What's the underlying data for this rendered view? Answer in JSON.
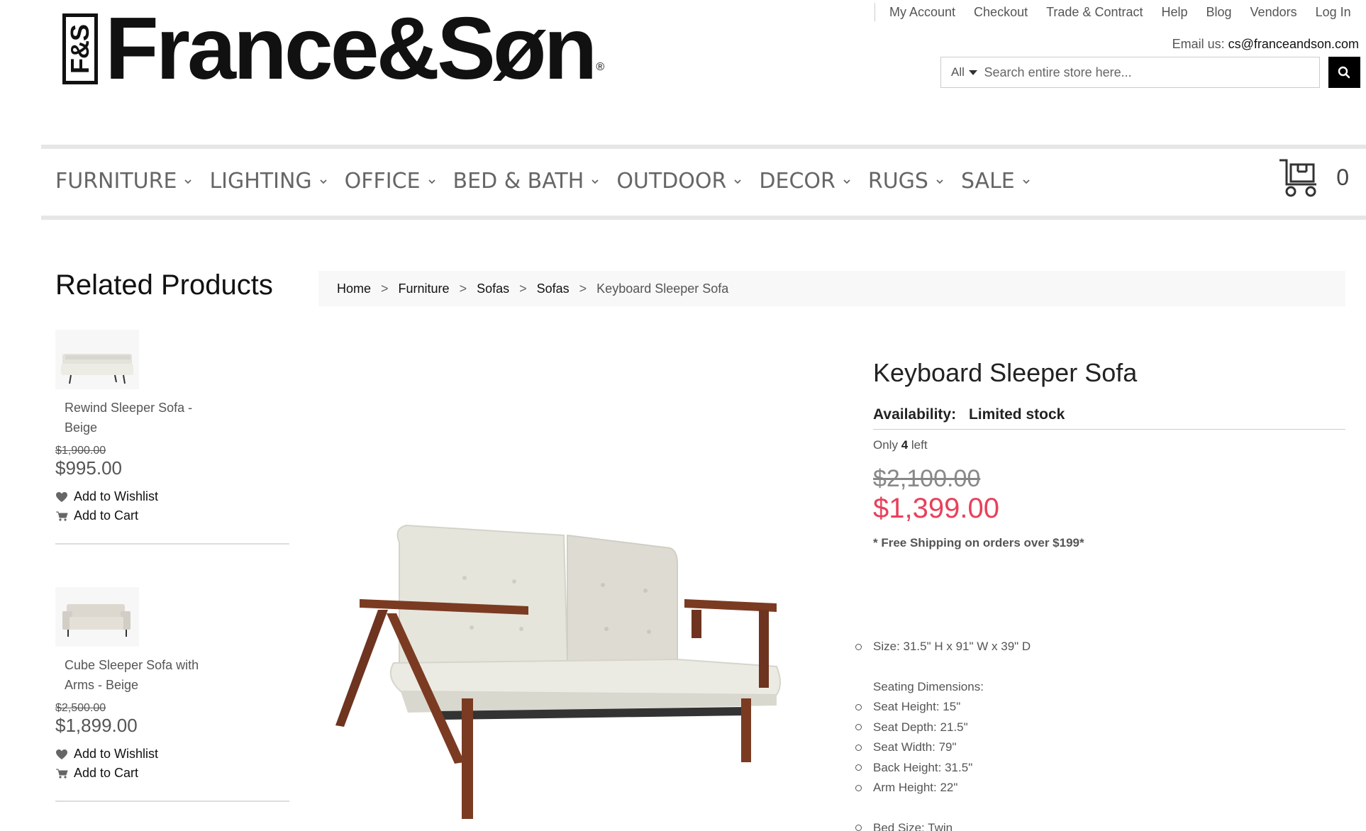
{
  "logo": {
    "mark": "F&S",
    "text": "France&Søn",
    "reg": "®"
  },
  "top_links": [
    "My Account",
    "Checkout",
    "Trade & Contract",
    "Help",
    "Blog",
    "Vendors",
    "Log In"
  ],
  "email": {
    "label": "Email us:",
    "address": "cs@franceandson.com"
  },
  "search": {
    "category": "All",
    "placeholder": "Search entire store here..."
  },
  "nav": [
    "FURNITURE",
    "LIGHTING",
    "OFFICE",
    "BED & BATH",
    "OUTDOOR",
    "DECOR",
    "RUGS",
    "SALE"
  ],
  "cart": {
    "count": "0"
  },
  "sidebar": {
    "title": "Related Products",
    "items": [
      {
        "name": "Rewind Sleeper Sofa - Beige",
        "old_price": "$1,900.00",
        "price": "$995.00",
        "wishlist": "Add to Wishlist",
        "cart": "Add to Cart"
      },
      {
        "name": "Cube Sleeper Sofa with Arms - Beige",
        "old_price": "$2,500.00",
        "price": "$1,899.00",
        "wishlist": "Add to Wishlist",
        "cart": "Add to Cart"
      }
    ]
  },
  "breadcrumb": [
    "Home",
    "Furniture",
    "Sofas",
    "Sofas",
    "Keyboard Sleeper Sofa"
  ],
  "product": {
    "title": "Keyboard Sleeper Sofa",
    "availability_label": "Availability:",
    "availability_value": "Limited stock",
    "stock_prefix": "Only",
    "stock_count": "4",
    "stock_suffix": "left",
    "old_price": "$2,100.00",
    "price": "$1,399.00",
    "shipping": "* Free Shipping on orders over $199*",
    "size": "Size: 31.5\" H x 91\" W x 39\" D",
    "seating_heading": "Seating Dimensions:",
    "seating": [
      "Seat Height: 15\"",
      "Seat Depth: 21.5\"",
      "Seat Width: 79\"",
      "Back Height: 31.5\"",
      "Arm Height: 22\""
    ],
    "bed_size": "Bed Size: Twin"
  },
  "colors": {
    "sale_red": "#e8415a",
    "nav_gray": "#666666",
    "wood": "#7a3b22",
    "fabric": "#e9e8df"
  }
}
